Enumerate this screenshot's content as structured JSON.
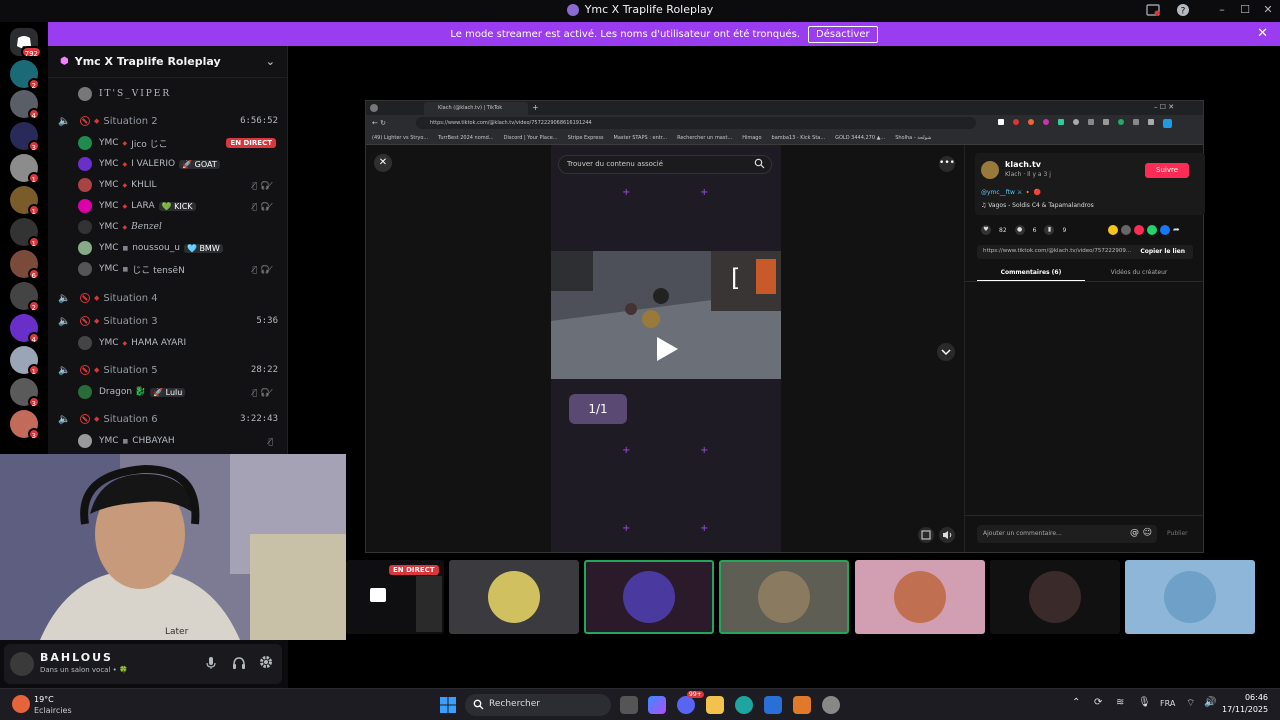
{
  "window": {
    "title": "Ymc X Traplife Roleplay"
  },
  "banner": {
    "message": "Le mode streamer est activé. Les noms d'utilisateur ont été tronqués.",
    "button": "Désactiver"
  },
  "rail": {
    "home_badge": "792",
    "badges": [
      "2",
      "4",
      "3",
      "1",
      "1",
      "1",
      "6",
      "2",
      "4",
      "1",
      "3",
      "3"
    ]
  },
  "server": {
    "name": "Ymc X Traplife Roleplay"
  },
  "channels": {
    "top_user": "IT'S_VIPER",
    "situation2": {
      "name": "Situation 2",
      "time": "6:56:52"
    },
    "s2_users": [
      {
        "prefix": "YMC",
        "name": "Jico じこ",
        "live": "EN DIRECT"
      },
      {
        "prefix": "YMC",
        "name": "I VALERIO",
        "tag": "🚀 GOAT"
      },
      {
        "prefix": "YMC",
        "name": "KHLIL"
      },
      {
        "prefix": "YMC",
        "name": "LARA",
        "tag": "💚 KICK"
      },
      {
        "prefix": "YMC",
        "name": "Benzel"
      },
      {
        "prefix": "YMC",
        "name": "noussou_u",
        "tag": "🩵 BMW"
      },
      {
        "prefix": "YMC",
        "name": "じこ tensēN"
      }
    ],
    "situation4": {
      "name": "Situation 4"
    },
    "situation3": {
      "name": "Situation 3",
      "time": "5:36"
    },
    "s3_users": [
      {
        "prefix": "YMC",
        "name": "HAMA AYARI"
      }
    ],
    "situation5": {
      "name": "Situation 5",
      "time": "28:22"
    },
    "s5_users": [
      {
        "name": "Dragon 🐉",
        "tag": "🚀 Lulu"
      }
    ],
    "situation6": {
      "name": "Situation 6",
      "time": "3:22:43"
    },
    "s6_users": [
      {
        "prefix": "YMC",
        "name": "CHBAYAH"
      }
    ]
  },
  "user_panel": {
    "name": "BAHLOUS",
    "status": "Dans un salon vocal • 🍀"
  },
  "browser": {
    "tab_title": "Klach (@klach.tv) | TikTok",
    "url": "https://www.tiktok.com/@klach.tv/video/7572229068616191244",
    "bookmarks": [
      "(49) Lighter vs Stryo...",
      "TurrBest 2024 nomd...",
      "Discord | Your Place...",
      "Stripe Express",
      "Master STAPS : entr...",
      "Rechercher un mast...",
      "Himago",
      "bamba13 - Kick Sta...",
      "GOLD 3444,270 ▲...",
      "Sholha - شولحة"
    ],
    "search_placeholder": "Trouver du contenu associé",
    "counter": "1/1",
    "author_name": "klach.tv",
    "author_meta": "Klach · Il y a 3 j",
    "follow": "Suivre",
    "caption": "@ymc__ftw ⚔ 🔸 🔴",
    "music": "♫  Vagos - Soldis C4 & Tapamalandros",
    "likes": "82",
    "comments_count": "6",
    "saves": "9",
    "link": "https://www.tiktok.com/@klach.tv/video/757222909...",
    "copy_link": "Copier le lien",
    "tab_comments": "Commentaires (6)",
    "tab_creator": "Vidéos du créateur",
    "comment_placeholder": "Ajouter un commentaire...",
    "publish": "Publier"
  },
  "thumbs": {
    "live_label": "EN DIRECT"
  },
  "taskbar": {
    "weather_temp": "19°C",
    "weather_desc": "Eclaircies",
    "search": "Rechercher",
    "lang": "FRA",
    "time": "06:46",
    "date": "17/11/2025",
    "notif": "99+"
  },
  "colors": {
    "banner": "#9a3cf0",
    "live": "#da373c",
    "follow": "#fe2c55",
    "voice": "#23a55a"
  }
}
